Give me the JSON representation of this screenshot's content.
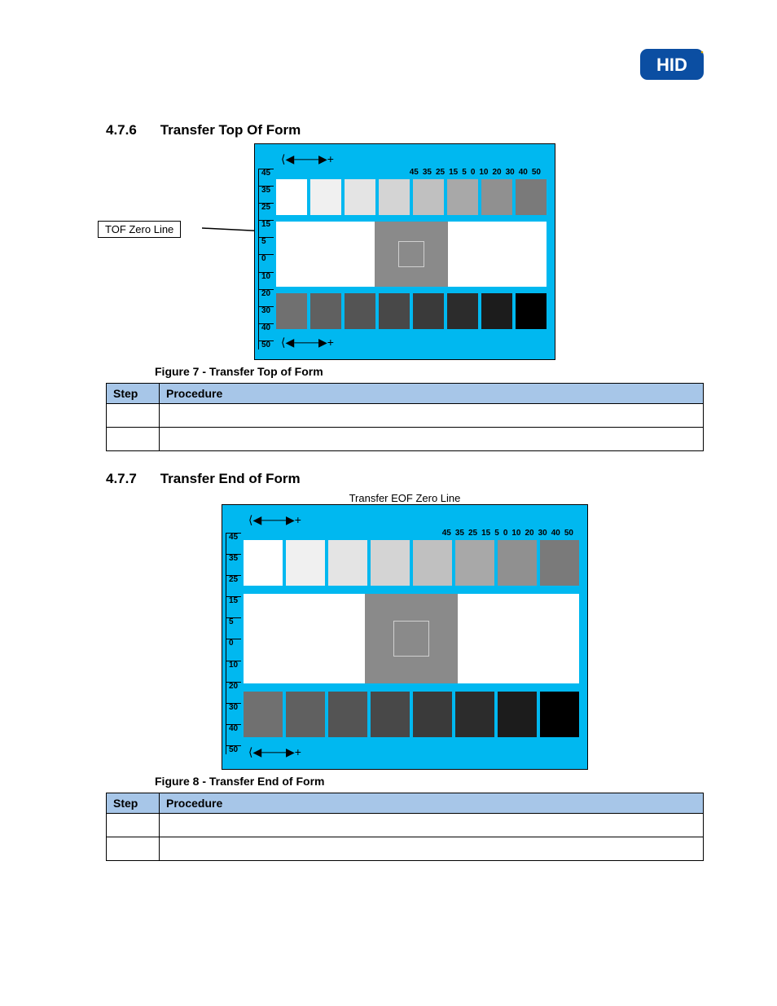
{
  "logo_text": "HID",
  "section1": {
    "number": "4.7.6",
    "title": "Transfer Top Of Form",
    "callout": "TOF Zero Line",
    "caption": "Figure 7 - Transfer Top of Form"
  },
  "section2": {
    "number": "4.7.7",
    "title": "Transfer End of Form",
    "zero_line_label": "Transfer EOF Zero Line",
    "caption": "Figure 8 - Transfer End of Form"
  },
  "table": {
    "headers": {
      "step": "Step",
      "procedure": "Procedure"
    }
  },
  "ruler_top": [
    "45",
    "35",
    "25",
    "15",
    "5",
    "0",
    "10",
    "20",
    "30",
    "40",
    "50"
  ],
  "ruler_left": [
    "45",
    "35",
    "25",
    "15",
    "5",
    "0",
    "10",
    "20",
    "30",
    "40",
    "50"
  ],
  "swatches": {
    "top_row": [
      "#ffffff",
      "#f0f0f0",
      "#e4e4e4",
      "#d4d4d4",
      "#c0c0c0",
      "#a8a8a8",
      "#909090",
      "#7a7a7a"
    ],
    "bottom_row": [
      "#707070",
      "#606060",
      "#545454",
      "#484848",
      "#3a3a3a",
      "#2c2c2c",
      "#1c1c1c",
      "#000000"
    ]
  }
}
